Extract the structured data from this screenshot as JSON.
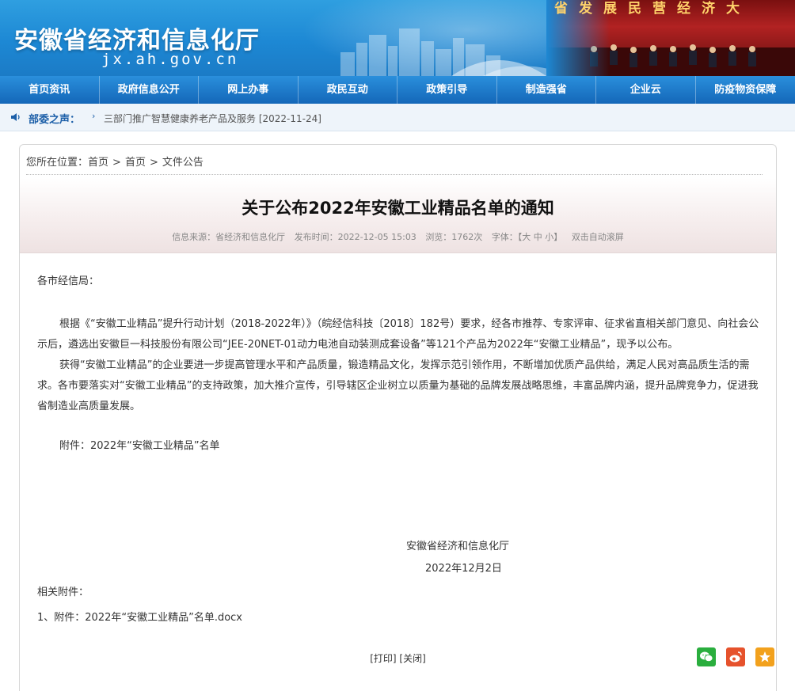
{
  "header": {
    "site_title": "安徽省经济和信息化厅",
    "domain": "jx.ah.gov.cn",
    "banner_slogan": "省发展民营经济大"
  },
  "nav": {
    "items": [
      "首页资讯",
      "政府信息公开",
      "网上办事",
      "政民互动",
      "政策引导",
      "制造强省",
      "企业云",
      "防疫物资保障"
    ]
  },
  "notice": {
    "label": "部委之声：",
    "arrow": "›",
    "text": "三部门推广智慧健康养老产品及服务 [2022-11-24]"
  },
  "breadcrumb": {
    "prefix": "您所在位置：",
    "items": [
      "首页",
      "首页",
      "文件公告"
    ],
    "separator": ">"
  },
  "article": {
    "title": "关于公布2022年安徽工业精品名单的通知",
    "meta": {
      "source": "信息来源：省经济和信息化厅",
      "published": "发布时间：2022-12-05 15:03",
      "views": "浏览：1762次",
      "font_size": "字体：【大 中 小】",
      "autoscroll": "双击自动滚屏"
    },
    "salutation": "各市经信局：",
    "paragraph1": "根据《“安徽工业精品”提升行动计划（2018-2022年）》（皖经信科技〔2018〕182号）要求，经各市推荐、专家评审、征求省直相关部门意见、向社会公示后，遴选出安徽巨一科技股份有限公司“JEE-20NET-01动力电池自动装测成套设备”等121个产品为2022年“安徽工业精品”，现予以公布。",
    "paragraph2": "获得“安徽工业精品”的企业要进一步提高管理水平和产品质量，锻造精品文化，发挥示范引领作用，不断增加优质产品供给，满足人民对高品质生活的需求。各市要落实对“安徽工业精品”的支持政策，加大推介宣传，引导辖区企业树立以质量为基础的品牌发展战略思维，丰富品牌内涵，提升品牌竞争力，促进我省制造业高质量发展。",
    "attachment_note": "附件：2022年“安徽工业精品”名单",
    "signature_org": "安徽省经济和信息化厅",
    "signature_date": "2022年12月2日",
    "related_label": "相关附件：",
    "related_file": "1、附件：2022年“安徽工业精品”名单.docx"
  },
  "footer": {
    "print": "[打印]",
    "close": "[关闭]"
  },
  "share": {
    "wechat_color": "#2aae3e",
    "weibo_color": "#e6522c",
    "favorite_color": "#f2a11d"
  }
}
